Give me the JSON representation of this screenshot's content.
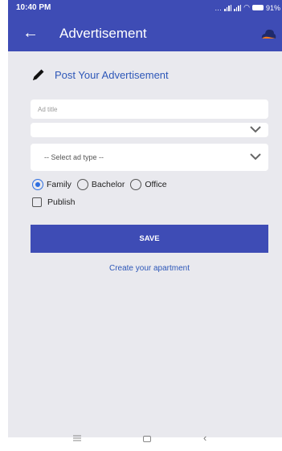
{
  "status_bar": {
    "time": "10:40 PM",
    "battery": "91%"
  },
  "app_bar": {
    "title": "Advertisement",
    "back_icon": "arrow-left-icon",
    "app_icon": "cloud-icon"
  },
  "form": {
    "heading": "Post Your Advertisement",
    "ad_title": {
      "value": "",
      "placeholder": "Ad title"
    },
    "category_select": {
      "selected": ""
    },
    "ad_type_select": {
      "selected": "-- Select ad type --"
    },
    "radios": [
      {
        "label": "Family",
        "checked": true
      },
      {
        "label": "Bachelor",
        "checked": false
      },
      {
        "label": "Office",
        "checked": false
      }
    ],
    "publish": {
      "label": "Publish",
      "checked": false
    },
    "save_label": "SAVE",
    "create_link": "Create your apartment"
  },
  "colors": {
    "primary": "#3e4cb5",
    "link": "#2d57b8",
    "radio_active": "#2f6fe0",
    "background": "#e9e9ee"
  }
}
